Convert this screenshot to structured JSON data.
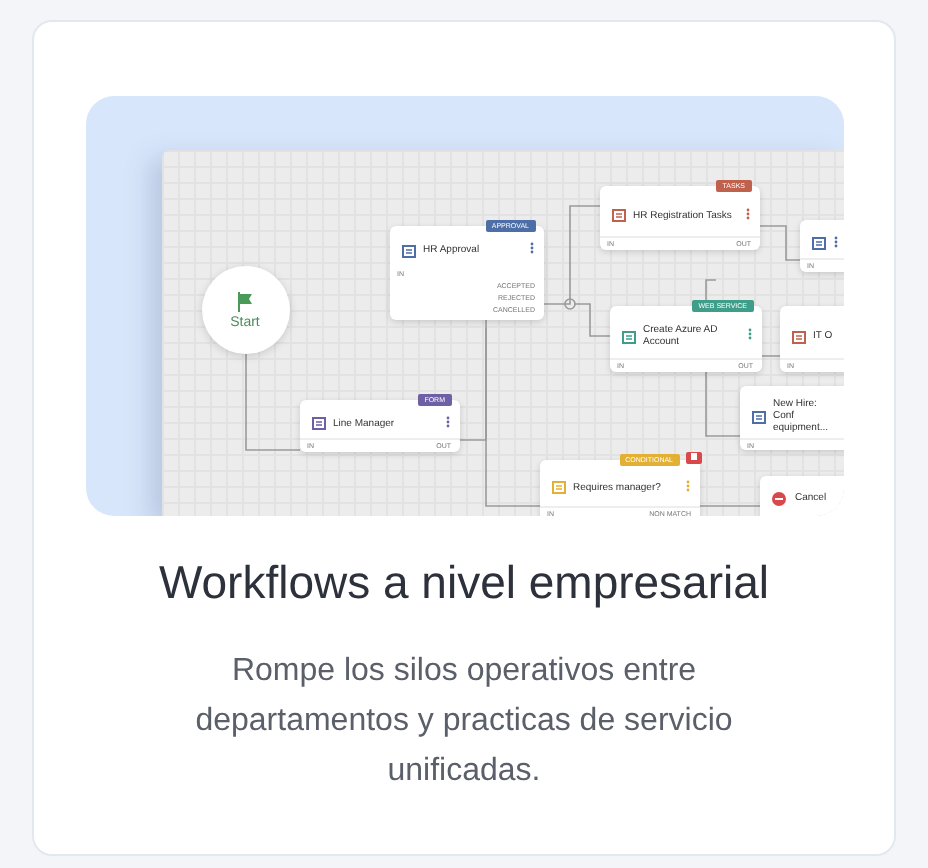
{
  "card": {
    "illustration": {
      "nodes": [
        {
          "kind": "start",
          "title": "Start"
        },
        {
          "kind": "task",
          "title": "HR Approval",
          "badge": "APPROVAL",
          "color": "#4d6ea6",
          "in_label": "IN",
          "outputs": [
            "ACCEPTED",
            "REJECTED",
            "CANCELLED"
          ]
        },
        {
          "kind": "task",
          "title": "HR Registration Tasks",
          "badge": "TASKS",
          "color": "#c0614e",
          "in_label": "IN",
          "out_label": "OUT"
        },
        {
          "kind": "task",
          "color": "#4d6ea6",
          "in_label": "IN"
        },
        {
          "kind": "task",
          "title": "Create Azure AD Account",
          "badge": "WEB SERVICE",
          "color": "#3f9e8a",
          "in_label": "IN",
          "out_label": "OUT"
        },
        {
          "kind": "task",
          "title": "IT O",
          "color": "#c0614e",
          "in_label": "IN"
        },
        {
          "kind": "task",
          "title": "Line Manager",
          "badge": "FORM",
          "color": "#6f60a6",
          "in_label": "IN",
          "out_label": "OUT"
        },
        {
          "kind": "task",
          "title": "New Hire: Conf equipment...",
          "color": "#4d6ea6",
          "in_label": "IN"
        },
        {
          "kind": "task",
          "title": "Requires manager?",
          "badge": "CONDITIONAL",
          "color": "#e2b032",
          "deletable": true,
          "in_label": "IN",
          "out_label": "NON MATCH"
        },
        {
          "kind": "end",
          "title": "Cancel"
        }
      ]
    },
    "title": "Workflows a nivel empresarial",
    "description": "Rompe los silos operativos entre departamentos y practicas de servicio unificadas."
  }
}
